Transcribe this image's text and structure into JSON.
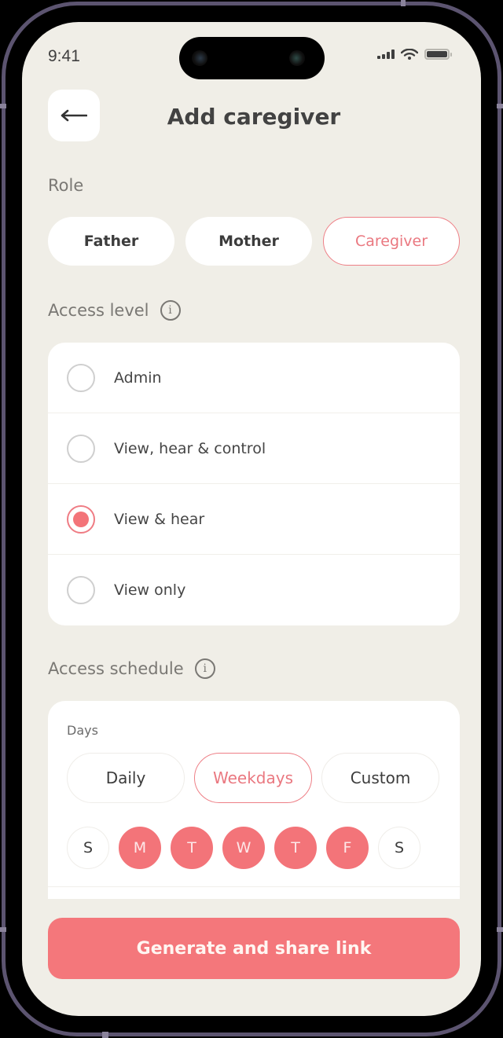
{
  "status_bar": {
    "time": "9:41",
    "icons": [
      "cellular-signal-icon",
      "wifi-icon",
      "battery-icon"
    ]
  },
  "header": {
    "back_icon": "arrow-left-icon",
    "title": "Add caregiver"
  },
  "role": {
    "label": "Role",
    "options": [
      {
        "label": "Father",
        "selected": false
      },
      {
        "label": "Mother",
        "selected": false
      },
      {
        "label": "Caregiver",
        "selected": true
      }
    ]
  },
  "access_level": {
    "label": "Access level",
    "info_icon": "info-icon",
    "options": [
      {
        "label": "Admin",
        "checked": false
      },
      {
        "label": "View, hear & control",
        "checked": false
      },
      {
        "label": "View & hear",
        "checked": true
      },
      {
        "label": "View only",
        "checked": false
      }
    ]
  },
  "access_schedule": {
    "label": "Access schedule",
    "info_icon": "info-icon",
    "days_label": "Days",
    "frequency_options": [
      {
        "label": "Daily",
        "selected": false
      },
      {
        "label": "Weekdays",
        "selected": true
      },
      {
        "label": "Custom",
        "selected": false
      }
    ],
    "days": [
      {
        "label": "S",
        "on": false
      },
      {
        "label": "M",
        "on": true
      },
      {
        "label": "T",
        "on": true
      },
      {
        "label": "W",
        "on": true
      },
      {
        "label": "T",
        "on": true
      },
      {
        "label": "F",
        "on": true
      },
      {
        "label": "S",
        "on": false
      }
    ]
  },
  "cta": {
    "label": "Generate and share link"
  },
  "colors": {
    "accent": "#f4777b",
    "background": "#f0eee7",
    "card": "#ffffff",
    "text_primary": "#3c3c3c",
    "text_secondary": "#7a7874"
  }
}
